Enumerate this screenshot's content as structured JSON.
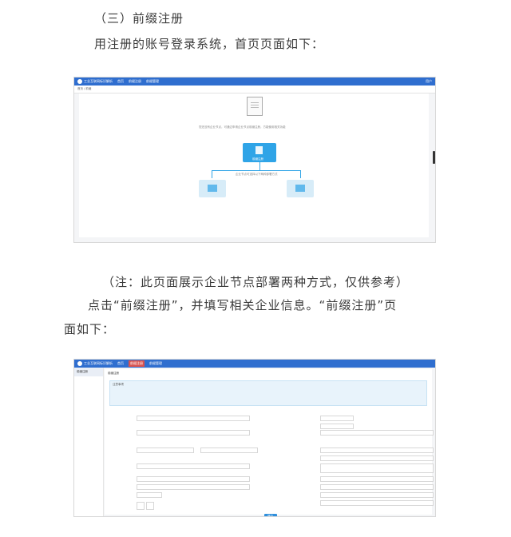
{
  "heading": "（三）前缀注册",
  "intro": "用注册的账号登录系统，首页页面如下：",
  "note": "（注：此页面展示企业节点部署两种方式，仅供参考）",
  "step_line1": "点击“前缀注册”，并填写相关企业信息。“前缀注册”页",
  "step_line2": "面如下：",
  "screenshot1": {
    "app_title": "工业互联网标识解析",
    "tabs": [
      "首页",
      "前缀注册",
      "前缀管理"
    ],
    "user": "用户",
    "breadcrumb": "首页 / 前缀",
    "description": "您还没有企业节点，可通过申请企业节点前缀注册，方能使用相关功能",
    "main_box": "前缀注册",
    "branch_caption": "企业节点可选择以下两种部署方式"
  },
  "screenshot2": {
    "app_title": "工业互联网标识解析",
    "tabs": [
      "首页",
      "前缀注册",
      "前缀管理"
    ],
    "sidebar_item": "前缀注册",
    "section_title": "前缀注册",
    "hint_title": "注意事项",
    "submit": "提交"
  }
}
